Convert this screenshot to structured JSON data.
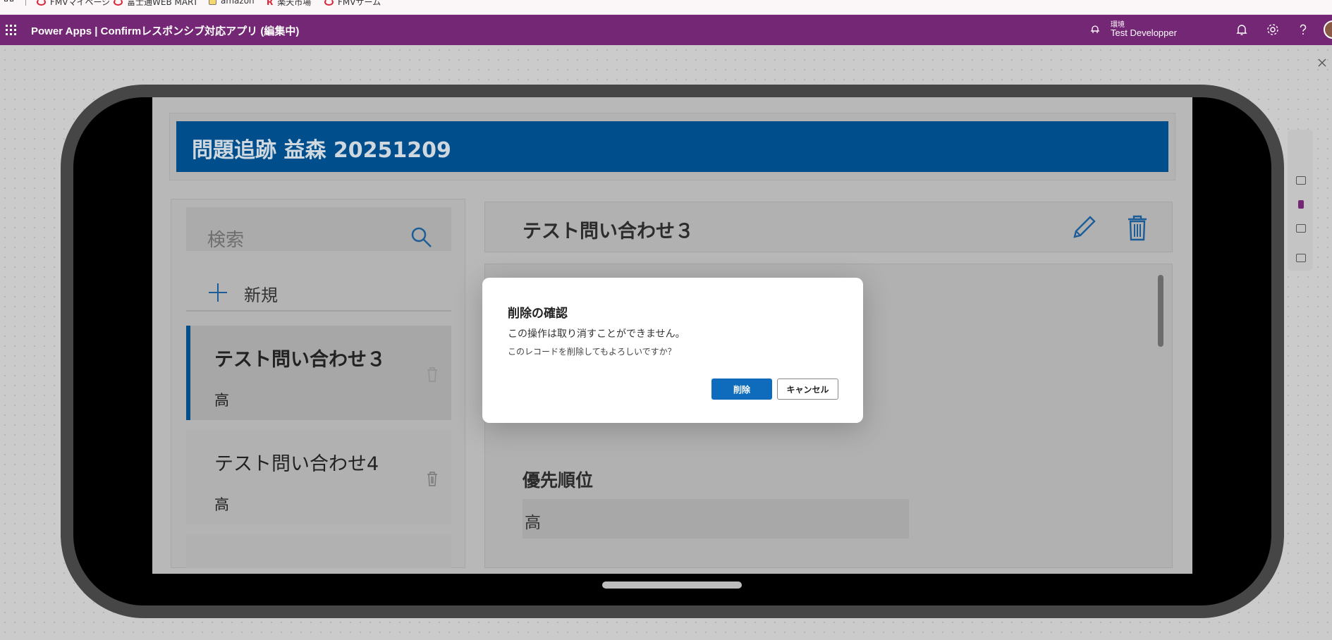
{
  "bookmarks": [
    {
      "label": "FMVマイページ",
      "icon": "fujitsu-icon"
    },
    {
      "label": "富士通WEB MART",
      "icon": "fujitsu-icon"
    },
    {
      "label": "amazon",
      "icon": "amazon-icon"
    },
    {
      "label": "楽天市場",
      "icon": "rakuten-icon"
    },
    {
      "label": "FMVサーム",
      "icon": "fujitsu-icon"
    }
  ],
  "header": {
    "app_name": "Power Apps  |  Confirmレスポンシブ対応アプリ (編集中)",
    "environment_label": "環境",
    "environment_name": "Test Developper",
    "accent_color": "#742774"
  },
  "app": {
    "title": "問題追跡 益森 20251209",
    "search_placeholder": "検索",
    "new_label": "新規",
    "list": [
      {
        "title": "テスト問い合わせ３",
        "priority": "高",
        "selected": true
      },
      {
        "title": "テスト問い合わせ4",
        "priority": "高",
        "selected": false
      }
    ],
    "detail": {
      "title": "テスト問い合わせ３",
      "priority_label": "優先順位",
      "priority_value": "高"
    }
  },
  "dialog": {
    "title": "削除の確認",
    "message": "この操作は取り消すことができません。",
    "sub_message": "このレコードを削除してもよろしいですか？",
    "confirm_label": "削除",
    "cancel_label": "キャンセル",
    "primary_color": "#0f6cbd"
  }
}
